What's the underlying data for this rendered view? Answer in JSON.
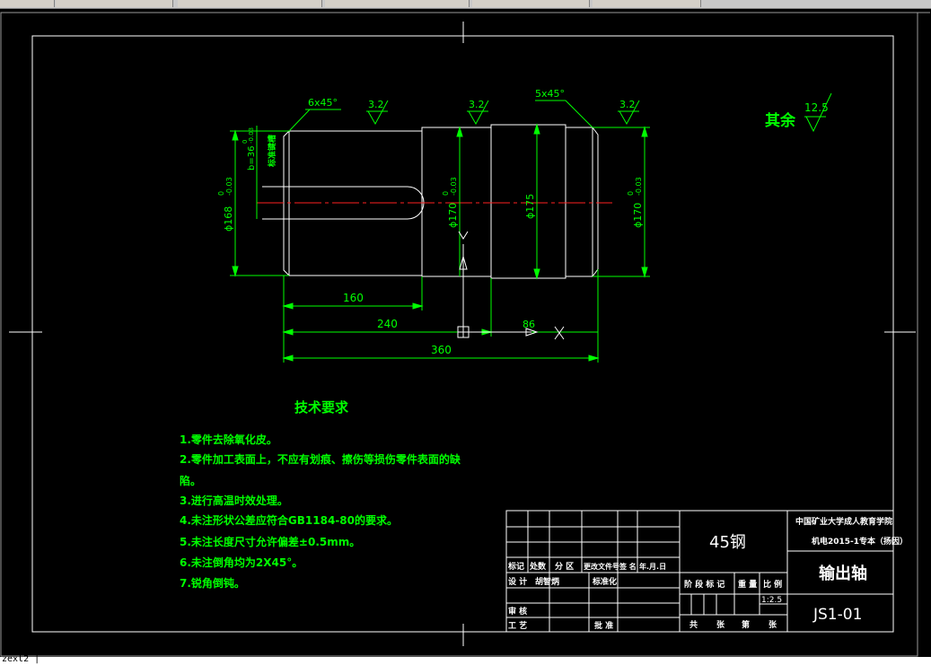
{
  "window": {
    "command_line": "zext2 |"
  },
  "drawing": {
    "surface_roughness": {
      "mark_1": "3.2",
      "mark_2": "3.2",
      "mark_3": "3.2",
      "remaining_label": "其余",
      "remaining_value": "12.5"
    },
    "chamfers": {
      "left": "6x45°",
      "right": "5x45°"
    },
    "diameters": {
      "d1": "ϕ168",
      "d1_tol_upper": "0",
      "d1_tol_lower": "-0.03",
      "d2": "ϕ170",
      "d2_tol_upper": "0",
      "d2_tol_lower": "-0.03",
      "d3": "ϕ175",
      "d4": "ϕ170",
      "d4_tol_upper": "0",
      "d4_tol_lower": "-0.03"
    },
    "keyway": {
      "width": "b=36",
      "tol_upper": "0",
      "tol_lower": "-0.03",
      "note": "标准键槽"
    },
    "lengths": {
      "l1": "160",
      "l2": "240",
      "l3": "360",
      "l4": "86"
    },
    "ucs_label": "Y"
  },
  "tech_requirements": {
    "title": "技术要求",
    "items": [
      "1.零件去除氧化皮。",
      "2.零件加工表面上，不应有划痕、擦伤等损伤零件表面的缺",
      "陷。",
      "3.进行高温时效处理。",
      "4.未注形状公差应符合GB1184-80的要求。",
      "5.未注长度尺寸允许偏差±0.5mm。",
      "6.未注倒角均为2X45°。",
      "7.锐角倒钝。"
    ]
  },
  "title_block": {
    "material": "45钢",
    "school": "中国矿业大学成人教育学院",
    "class": "机电2015-1专本（扬因）",
    "part_name": "输出轴",
    "drawing_no": "JS1-01",
    "scale": "1:2.5",
    "headers": {
      "mark": "标记",
      "count": "处数",
      "zone": "分 区",
      "change_doc": "更改文件号",
      "signature": "签 名",
      "date": "年.月.日",
      "design": "设 计",
      "designer": "胡智炳",
      "standardization": "标准化",
      "stage_mark": "阶 段 标 记",
      "weight": "重 量",
      "ratio": "比 例",
      "review": "审 核",
      "process": "工 艺",
      "approve": "批 准",
      "sheets_total": "共",
      "sheets": "张",
      "sheet_no": "第",
      "sheet": "张"
    }
  },
  "colors": {
    "green": "#00ff00",
    "white": "#ffffff",
    "red": "#ff2020",
    "background": "#000000"
  }
}
